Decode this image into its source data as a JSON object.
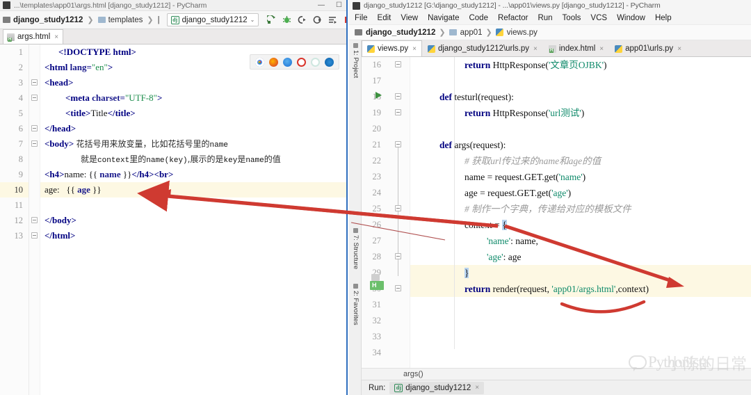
{
  "left_window": {
    "titlebar": {
      "text": "...\\templates\\app01\\args.html [django_study1212] - PyCharm",
      "minimize": "—",
      "maximize": "☐"
    },
    "breadcrumb": [
      {
        "label": "django_study1212",
        "icon": "folder-icon"
      },
      {
        "label": "templates",
        "icon": "folder-icon"
      },
      {
        "label": "|",
        "icon": "none"
      }
    ],
    "run_config": {
      "label": "django_study1212",
      "icon": "django-icon",
      "chevron": "⌄"
    },
    "toolbar_icons": [
      "run-icon",
      "debug-icon",
      "run-with-coverage-icon",
      "profile-icon",
      "run-task-icon",
      "stop-icon"
    ],
    "tabs": [
      {
        "label": "args.html",
        "icon": "html-file-icon",
        "close": "×",
        "active": true
      }
    ],
    "browser_bar": [
      "chrome-icon",
      "firefox-icon",
      "safari-icon",
      "opera-icon",
      "ie-icon",
      "edge-icon"
    ],
    "code": {
      "line_numbers": [
        "1",
        "2",
        "3",
        "4",
        "5",
        "6",
        "7",
        "8",
        "9",
        "10",
        "11",
        "12",
        "13"
      ],
      "current_line": 10,
      "lines": [
        {
          "n": 1,
          "text": "<!DOCTYPE html>"
        },
        {
          "n": 2,
          "text": "<html lang=\"en\">"
        },
        {
          "n": 3,
          "text": "<head>"
        },
        {
          "n": 4,
          "text": "    <meta charset=\"UTF-8\">"
        },
        {
          "n": 5,
          "text": "    <title>Title</title>"
        },
        {
          "n": 6,
          "text": "</head>"
        },
        {
          "n": 7,
          "text": "<body> 花括号用来放变量，比如花括号里的name"
        },
        {
          "n": 8,
          "text": "      就是context里的name(key),展示的是key是name的值"
        },
        {
          "n": 9,
          "text": "<h4>name: {{ name }}</h4><br>"
        },
        {
          "n": 10,
          "text": "age:   {{ age }}"
        },
        {
          "n": 11,
          "text": ""
        },
        {
          "n": 12,
          "text": "</body>"
        },
        {
          "n": 13,
          "text": "</html>"
        }
      ],
      "tokens": {
        "doctype": "<!DOCTYPE html>",
        "html_open": "<html",
        "lang_attr": "lang=",
        "lang_val": "\"en\"",
        "head_open": "<head>",
        "meta": "<meta",
        "charset_attr": "charset=",
        "charset_val": "\"UTF-8\"",
        "title_open": "<title>",
        "title_text": "Title",
        "title_close": "</title>",
        "head_close": "</head>",
        "body_open": "<body>",
        "comment_cn_1": "花括号用来放变量，比如花括号里的",
        "comment_cn_1_tail": "name",
        "comment_cn_2a": "就是",
        "comment_cn_2b": "context",
        "comment_cn_2c": "里的",
        "comment_cn_2d": "name(key)",
        "comment_cn_2e": ",展示的是",
        "comment_cn_2f": "key",
        "comment_cn_2g": "是",
        "comment_cn_2h": "name",
        "comment_cn_2i": "的值",
        "h4_open": "<h4>",
        "name_label": "name: ",
        "mustache_name_l": "{{ ",
        "mustache_name_v": "name",
        "mustache_name_r": " }}",
        "h4_close": "</h4>",
        "br": "<br>",
        "age_label": "age:   ",
        "mustache_age_l": "{{ ",
        "mustache_age_v": "age",
        "mustache_age_r": " }}",
        "body_close": "</body>",
        "html_close": "</html>",
        "gt": ">"
      }
    }
  },
  "right_window": {
    "titlebar": {
      "text": "django_study1212 [G:\\django_study1212] - ...\\app01\\views.py [django_study1212] - PyCharm"
    },
    "menu": [
      "File",
      "Edit",
      "View",
      "Navigate",
      "Code",
      "Refactor",
      "Run",
      "Tools",
      "VCS",
      "Window",
      "Help"
    ],
    "breadcrumb": [
      {
        "label": "django_study1212",
        "icon": "folder-icon"
      },
      {
        "label": "app01",
        "icon": "folder-icon"
      },
      {
        "label": "views.py",
        "icon": "python-file-icon"
      }
    ],
    "tabs": [
      {
        "label": "views.py",
        "icon": "python-file-icon",
        "close": "×",
        "active": true
      },
      {
        "label": "django_study1212\\urls.py",
        "icon": "python-file-icon",
        "close": "×",
        "active": false
      },
      {
        "label": "index.html",
        "icon": "html-file-icon",
        "close": "×",
        "active": false
      },
      {
        "label": "app01\\urls.py",
        "icon": "python-file-icon",
        "close": "×",
        "active": false
      }
    ],
    "rail_left": [
      "1: Project"
    ],
    "rail_bottom": [
      "7: Structure",
      "2: Favorites"
    ],
    "code": {
      "current_line": 29,
      "lines": [
        {
          "n": 16,
          "text": "        return HttpResponse('文章页OJBK')"
        },
        {
          "n": 17,
          "text": ""
        },
        {
          "n": 18,
          "text": "    def testurl(request):"
        },
        {
          "n": 19,
          "text": "        return HttpResponse('url测试')"
        },
        {
          "n": 20,
          "text": ""
        },
        {
          "n": 21,
          "text": "    def args(request):"
        },
        {
          "n": 22,
          "text": "        # 获取url传过来的name和age的值"
        },
        {
          "n": 23,
          "text": "        name = request.GET.get('name')"
        },
        {
          "n": 24,
          "text": "        age = request.GET.get('age')"
        },
        {
          "n": 25,
          "text": "        # 制作一个字典，传递给对应的模板文件"
        },
        {
          "n": 26,
          "text": "        context = {"
        },
        {
          "n": 27,
          "text": "            'name': name,"
        },
        {
          "n": 28,
          "text": "            'age': age"
        },
        {
          "n": 29,
          "text": "        }"
        },
        {
          "n": 30,
          "text": "        return render(request, 'app01/args.html',context)"
        },
        {
          "n": 31,
          "text": ""
        },
        {
          "n": 32,
          "text": ""
        },
        {
          "n": 33,
          "text": ""
        },
        {
          "n": 34,
          "text": ""
        }
      ],
      "tokens": {
        "return": "return",
        "def": "def",
        "http_response": "HttpResponse",
        "str_article": "'文章页OJBK'",
        "fn_testurl": "testurl(request):",
        "str_urltest": "'url测试'",
        "fn_args": "args(request):",
        "comment_get": "# 获取url传过来的name和age的值",
        "line_name": "name = request.GET.get(",
        "str_name": "'name'",
        "line_age": "age = request.GET.get(",
        "str_age": "'age'",
        "comment_dict": "# 制作一个字典，传递给对应的模板文件",
        "context_eq": "context = ",
        "open_brace": "{",
        "close_brace": "}",
        "key_name": "'name'",
        "val_name": ": name,",
        "key_age": "'age'",
        "val_age": ": age",
        "render_call": "render(request, ",
        "str_template": "'app01/args.html'",
        "render_tail": ",context)",
        "paren_l": "(",
        "paren_r": ")"
      }
    },
    "status_text": "args()",
    "run_bar": {
      "label": "Run:",
      "config": "django_study1212",
      "icon": "django-icon",
      "close": "×"
    }
  },
  "watermark": {
    "latin": "Pythonista",
    "cn": "小陈的日常",
    "icon": "speech-bubble-icon"
  },
  "annotations": {
    "arrow_1": "arrow-from-context-to-age-line",
    "arrow_2": "arrow-from-brace-to-render-context",
    "underline": "red-underline-under-template-path"
  },
  "colors": {
    "accent_blue": "#2f6fbf",
    "keyword": "#000080",
    "string": "#0f8a6a",
    "comment": "#9a9a9a",
    "annotation_red": "#cf3a31",
    "current_line": "#fdf8e3",
    "tag": "#000082"
  }
}
